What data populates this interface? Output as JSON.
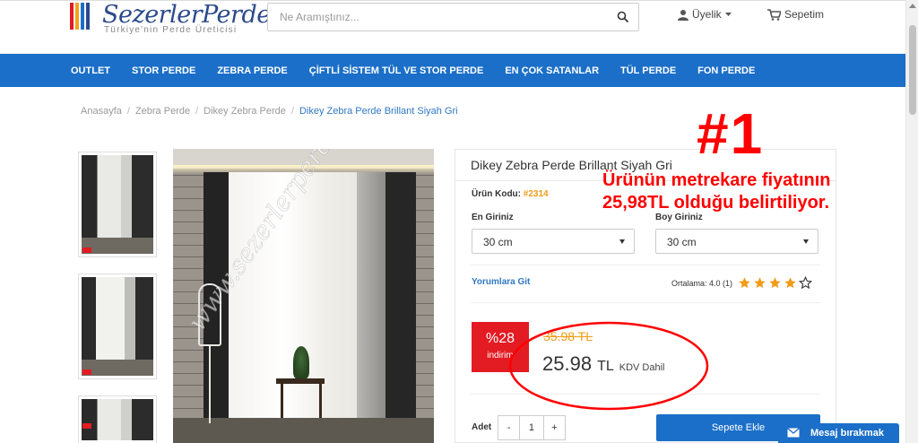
{
  "brand": {
    "name": "SezerlerPerde",
    "tagline": "Türkiye'nin Perde Üreticisi",
    "bar_colors": [
      "#e31b23",
      "#f2a31b",
      "#1b6fc8",
      "#2b4a8c"
    ]
  },
  "search": {
    "placeholder": "Ne Aramıştınız...",
    "icon": "search-icon"
  },
  "header": {
    "account_label": "Üyelik",
    "cart_label": "Sepetim"
  },
  "nav": {
    "items": [
      "OUTLET",
      "STOR PERDE",
      "ZEBRA PERDE",
      "ÇİFTLİ SİSTEM TÜL VE STOR PERDE",
      "EN ÇOK SATANLAR",
      "TÜL PERDE",
      "FON PERDE"
    ]
  },
  "breadcrumb": {
    "items": [
      "Anasayfa",
      "Zebra Perde",
      "Dikey Zebra Perde",
      "Dikey Zebra Perde Brillant Siyah Gri"
    ]
  },
  "image": {
    "watermark": "www.sezerlerperde.com"
  },
  "product": {
    "title": "Dikey Zebra Perde Brillant Siyah Gri",
    "code_label": "Ürün Kodu:",
    "code_value": "#2314",
    "width_label": "En Giriniz",
    "width_value": "30 cm",
    "height_label": "Boy Giriniz",
    "height_value": "30 cm",
    "reviews_link": "Yorumlara Git",
    "rating_text": "Ortalama: 4.0 (1)",
    "rating_value": 4,
    "rating_max": 5,
    "discount_percent": "%28",
    "discount_label": "indirim",
    "old_price": "35.98 TL",
    "new_price": "25.98",
    "currency": "TL",
    "vat_note": "KDV Dahil",
    "qty_label": "Adet",
    "qty_minus": "-",
    "qty_value": "1",
    "qty_plus": "+",
    "add_to_cart": "Sepete Ekle"
  },
  "annotation": {
    "number": "#1",
    "line1": "Ürünün metrekare fiyatının",
    "line2": "25,98TL olduğu belirtiliyor.",
    "color": "#ff0000"
  },
  "chat": {
    "label": "Mesaj bırakmak"
  },
  "colors": {
    "primary": "#1b6fc8",
    "accent": "#f29b18",
    "sale": "#e31b23"
  }
}
